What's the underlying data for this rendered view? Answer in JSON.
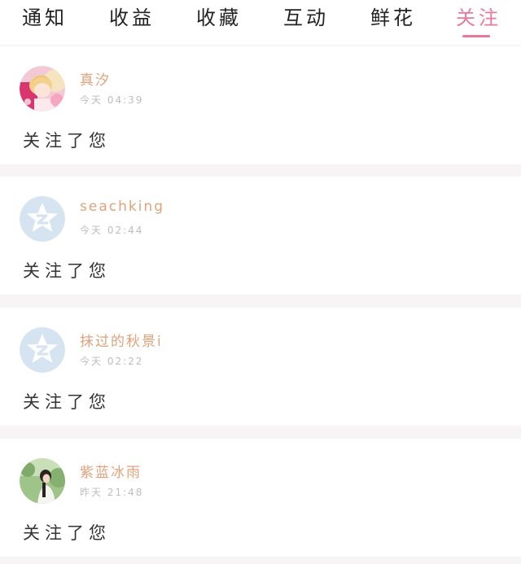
{
  "tabs": [
    {
      "label": "通知"
    },
    {
      "label": "收益"
    },
    {
      "label": "收藏"
    },
    {
      "label": "互动"
    },
    {
      "label": "鲜花"
    },
    {
      "label": "关注",
      "active": true
    }
  ],
  "accent_color": "#e8799a",
  "username_color": "#e0a27a",
  "notifications": [
    {
      "username": "真汐",
      "time": "今天 04:39",
      "message": "关注了您",
      "avatar": "anime-girl-avatar"
    },
    {
      "username": "seachking",
      "time": "今天 02:44",
      "message": "关注了您",
      "avatar": "default-star-avatar"
    },
    {
      "username": "抹过的秋景i",
      "time": "今天 02:22",
      "message": "关注了您",
      "avatar": "default-star-avatar"
    },
    {
      "username": "紫蓝冰雨",
      "time": "昨天 21:48",
      "message": "关注了您",
      "avatar": "photo-girl-avatar"
    }
  ]
}
